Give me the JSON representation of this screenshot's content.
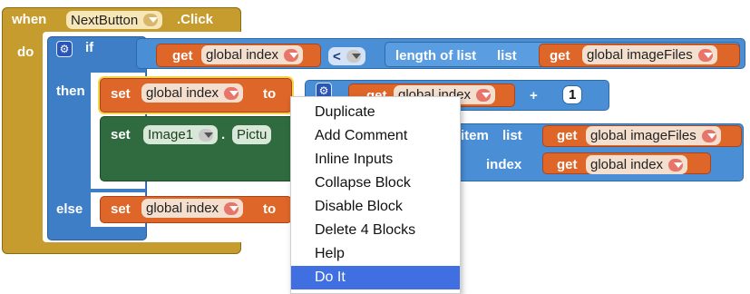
{
  "event": {
    "when": "when",
    "component": "NextButton",
    "event_name": ".Click",
    "do": "do"
  },
  "if_block": {
    "label": "if",
    "then": "then",
    "else": "else",
    "condition": {
      "get": "get",
      "var": "global index",
      "op": "<",
      "length_label": "length of list",
      "list_label": "list",
      "get2": "get",
      "var2": "global imageFiles"
    }
  },
  "then_set": {
    "set": "set",
    "var": "global index",
    "to": "to",
    "get": "get",
    "get_var": "global index",
    "plus": "+",
    "number": "1"
  },
  "set_image": {
    "set": "set",
    "component": "Image1",
    "dot": ".",
    "property": "Pictu",
    "item_label": "item",
    "list_label": "list",
    "get_list": "get",
    "list_var": "global imageFiles",
    "index_label": "index",
    "get_index": "get",
    "index_var": "global index"
  },
  "else_set": {
    "set": "set",
    "var": "global index",
    "to": "to"
  },
  "context_menu": {
    "items": [
      "Duplicate",
      "Add Comment",
      "Inline Inputs",
      "Collapse Block",
      "Disable Block",
      "Delete 4 Blocks",
      "Help",
      "Do It"
    ],
    "active_item": "Do It"
  },
  "colors": {
    "event": "#c59c2d",
    "control": "#3e7ec6",
    "variable": "#dd6628",
    "list": "#4a8fd6",
    "component_setter": "#2f6b3e",
    "menu_highlight": "#3f6fe0"
  }
}
